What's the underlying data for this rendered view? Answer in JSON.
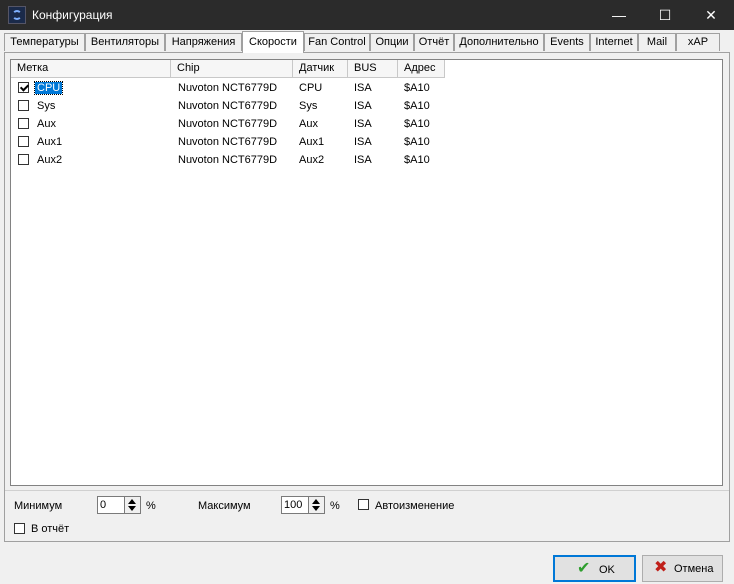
{
  "window": {
    "title": "Конфигурация"
  },
  "title_buttons": {
    "minimize": "—",
    "maximize": "☐",
    "close": "✕"
  },
  "tabs": [
    {
      "label": "Температуры"
    },
    {
      "label": "Вентиляторы"
    },
    {
      "label": "Напряжения"
    },
    {
      "label": "Скорости",
      "active": true
    },
    {
      "label": "Fan Control"
    },
    {
      "label": "Опции"
    },
    {
      "label": "Отчёт"
    },
    {
      "label": "Дополнительно"
    },
    {
      "label": "Events"
    },
    {
      "label": "Internet"
    },
    {
      "label": "Mail"
    },
    {
      "label": "xAP"
    }
  ],
  "table": {
    "columns": [
      "Метка",
      "Chip",
      "Датчик",
      "BUS",
      "Адрес"
    ],
    "rows": [
      {
        "checked": true,
        "label": "CPU",
        "chip": "Nuvoton NCT6779D",
        "sensor": "CPU",
        "bus": "ISA",
        "address": "$A10",
        "selected": true
      },
      {
        "checked": false,
        "label": "Sys",
        "chip": "Nuvoton NCT6779D",
        "sensor": "Sys",
        "bus": "ISA",
        "address": "$A10"
      },
      {
        "checked": false,
        "label": "Aux",
        "chip": "Nuvoton NCT6779D",
        "sensor": "Aux",
        "bus": "ISA",
        "address": "$A10"
      },
      {
        "checked": false,
        "label": "Aux1",
        "chip": "Nuvoton NCT6779D",
        "sensor": "Aux1",
        "bus": "ISA",
        "address": "$A10"
      },
      {
        "checked": false,
        "label": "Aux2",
        "chip": "Nuvoton NCT6779D",
        "sensor": "Aux2",
        "bus": "ISA",
        "address": "$A10"
      }
    ]
  },
  "settings": {
    "min_label": "Минимум",
    "min_value": "0",
    "min_unit": "%",
    "max_label": "Максимум",
    "max_value": "100",
    "max_unit": "%",
    "auto_label": "Автоизменение",
    "auto_checked": false,
    "report_label": "В отчёт",
    "report_checked": false
  },
  "buttons": {
    "ok": "OK",
    "cancel": "Отмена"
  },
  "colors": {
    "selection": "#0078d7",
    "ok_icon": "#2e9e2e",
    "cancel_icon": "#c0201a"
  }
}
